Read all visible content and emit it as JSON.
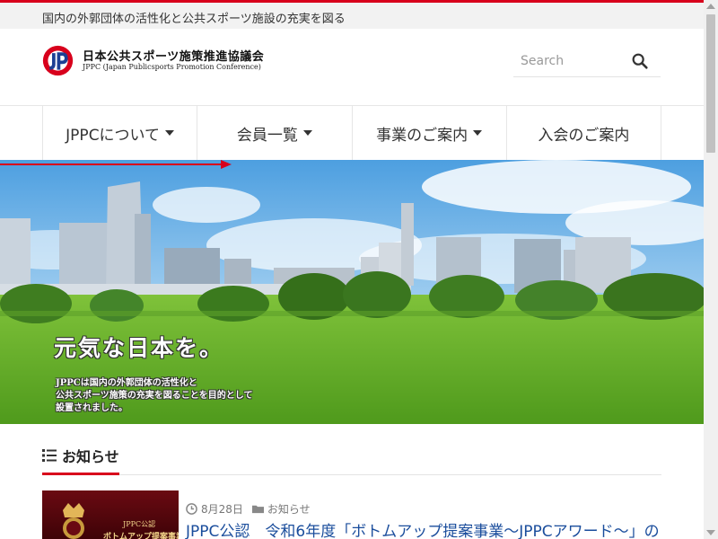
{
  "colors": {
    "accent": "#d8001c",
    "logo_blue": "#1c3f94",
    "link": "#1a4d9c"
  },
  "header": {
    "tagline": "国内の外郭団体の活性化と公共スポーツ施設の充実を図る",
    "logo_name": "日本公共スポーツ施策推進協議会",
    "logo_sub": "JPPC (Japan Publicsports Promotion Conference)"
  },
  "search": {
    "placeholder": "Search",
    "value": "",
    "icon": "search-icon"
  },
  "nav": {
    "items": [
      {
        "label": "JPPCについて",
        "has_dropdown": true
      },
      {
        "label": "会員一覧",
        "has_dropdown": true
      },
      {
        "label": "事業のご案内",
        "has_dropdown": true
      },
      {
        "label": "入会のご案内",
        "has_dropdown": false
      }
    ]
  },
  "hero": {
    "headline": "元気な日本を。",
    "lines": [
      "JPPCは国内の外郭団体の活性化と",
      "公共スポーツ施策の充実を図ることを目的として",
      "設置されました。"
    ]
  },
  "news": {
    "title": "お知らせ",
    "title_icon": "list-icon",
    "item": {
      "date": "8月28日",
      "category": "お知らせ",
      "title": "JPPC公認　令和6年度「ボトムアップ提案事業～JPPCアワード～」の",
      "thumb_line1": "JPPC公認",
      "thumb_line2": "ボトムアップ提案事業"
    }
  }
}
